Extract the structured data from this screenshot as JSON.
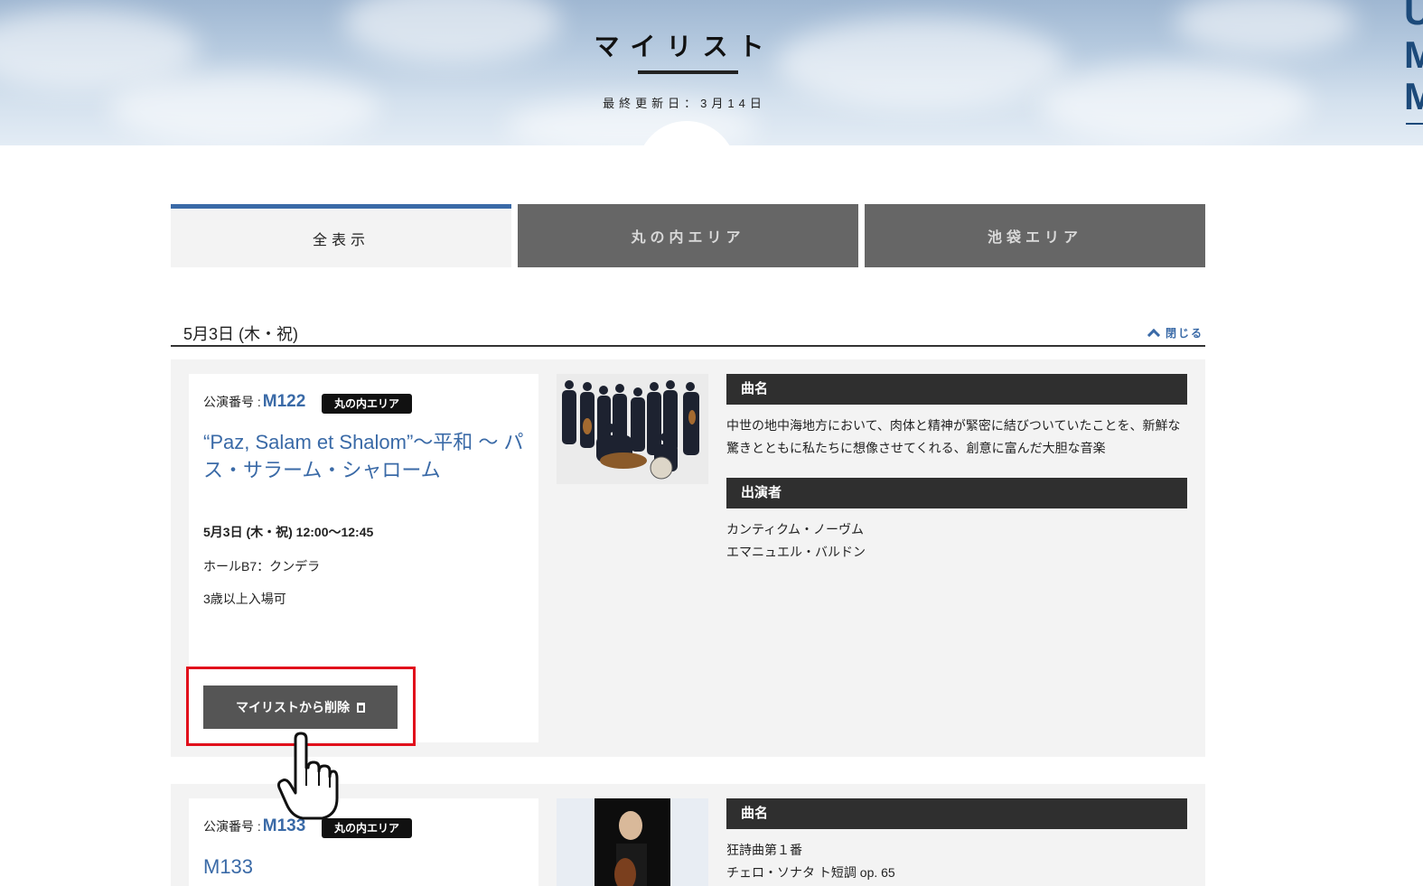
{
  "hero": {
    "title": "マイリスト",
    "updated": "最終更新日：3月14日",
    "side_logo": "U\nM\nM"
  },
  "tabs": [
    {
      "label": "全表示",
      "active": true
    },
    {
      "label": "丸の内エリア",
      "active": false
    },
    {
      "label": "池袋エリア",
      "active": false
    }
  ],
  "section": {
    "date": "5月3日 (木・祝)",
    "close_label": "閉じる"
  },
  "events": [
    {
      "perf_label": "公演番号 :",
      "perf_num": "M122",
      "area": "丸の内エリア",
      "title": "“Paz, Salam et Shalom”〜平和 〜 パス・サラーム・シャローム",
      "time": "5月3日 (木・祝) 12:00〜12:45",
      "hall": "ホールB7：クンデラ",
      "age": "3歳以上入場可",
      "remove_label": "マイリストから削除",
      "piece_head": "曲名",
      "piece_text": "中世の地中海地方において、肉体と精神が緊密に結びついていたことを、新鮮な驚きとともに私たちに想像させてくれる、創意に富んだ大胆な音楽",
      "performer_head": "出演者",
      "performers": [
        "カンティクム・ノーヴム",
        "エマニュエル・バルドン"
      ]
    },
    {
      "perf_label": "公演番号 :",
      "perf_num": "M133",
      "area": "丸の内エリア",
      "title": "M133",
      "piece_head": "曲名",
      "pieces": [
        "狂詩曲第１番",
        "チェロ・ソナタ ト短調 op. 65"
      ]
    }
  ],
  "colors": {
    "accent": "#3a6aa7",
    "tab_inactive": "#666666",
    "info_head": "#2f2f2f",
    "highlight": "#e10f1b"
  }
}
